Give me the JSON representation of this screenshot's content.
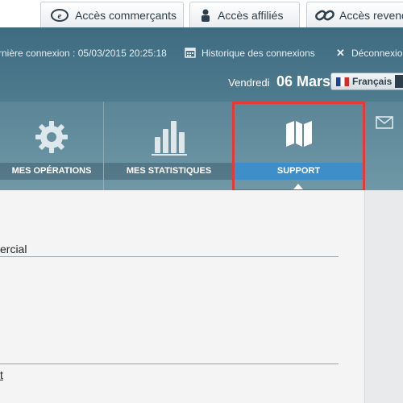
{
  "top_tabs": [
    {
      "label": "Accès commerçants",
      "icon": "e-logo-icon"
    },
    {
      "label": "Accès affiliés",
      "icon": "person-icon"
    },
    {
      "label": "Accès revend",
      "icon": "link-icon"
    }
  ],
  "header": {
    "last_connection": "rnière connexion : 05/03/2015 20:25:18",
    "history_link": "Historique des connexions",
    "logout_link": "Déconnexio",
    "day_label": "Vendredi",
    "date_label": "06 Mars",
    "language": "Français"
  },
  "menu": {
    "items": [
      {
        "label": "MES OPÉRATIONS",
        "icon": "gear-icon"
      },
      {
        "label": "MES STATISTIQUES",
        "icon": "bar-chart-icon"
      },
      {
        "label": "SUPPORT",
        "icon": "map-icon",
        "active": true
      }
    ],
    "mail_icon": "envelope-icon"
  },
  "content": {
    "row1": "ercial",
    "row2": "t"
  },
  "colors": {
    "header": "#4a7589",
    "menu": "#6690a0",
    "active": "#3e8fc9",
    "highlight": "#e53935"
  }
}
